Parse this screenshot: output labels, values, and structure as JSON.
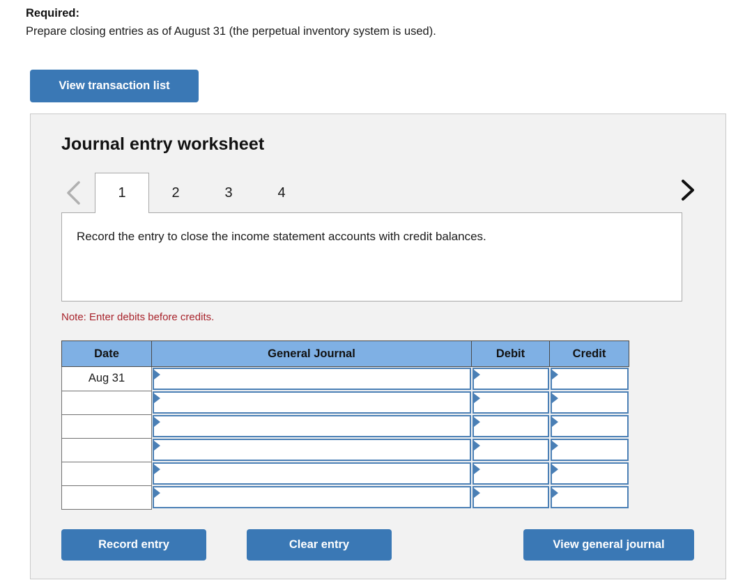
{
  "required": {
    "label": "Required:",
    "text": "Prepare closing entries as of August 31 (the perpetual inventory system is used)."
  },
  "toolbar": {
    "view_transaction_list_label": "View transaction list"
  },
  "worksheet": {
    "title": "Journal entry worksheet",
    "prev_icon": "chevron-left-icon",
    "next_icon": "chevron-right-icon",
    "tabs": [
      {
        "label": "1",
        "active": true
      },
      {
        "label": "2",
        "active": false
      },
      {
        "label": "3",
        "active": false
      },
      {
        "label": "4",
        "active": false
      }
    ],
    "instruction": "Record the entry to close the income statement accounts with credit balances.",
    "note": "Note: Enter debits before credits."
  },
  "journal_table": {
    "columns": [
      "Date",
      "General Journal",
      "Debit",
      "Credit"
    ],
    "rows": [
      {
        "date": "Aug 31",
        "general_journal": "",
        "debit": "",
        "credit": ""
      },
      {
        "date": "",
        "general_journal": "",
        "debit": "",
        "credit": ""
      },
      {
        "date": "",
        "general_journal": "",
        "debit": "",
        "credit": ""
      },
      {
        "date": "",
        "general_journal": "",
        "debit": "",
        "credit": ""
      },
      {
        "date": "",
        "general_journal": "",
        "debit": "",
        "credit": ""
      },
      {
        "date": "",
        "general_journal": "",
        "debit": "",
        "credit": ""
      }
    ]
  },
  "actions": {
    "record_entry_label": "Record entry",
    "clear_entry_label": "Clear entry",
    "view_general_journal_label": "View general journal"
  },
  "colors": {
    "button_blue": "#3a78b5",
    "table_header_blue": "#7fb0e4",
    "input_border_blue": "#4a7fb5",
    "note_red": "#a8232b",
    "panel_gray": "#f2f2f2"
  }
}
